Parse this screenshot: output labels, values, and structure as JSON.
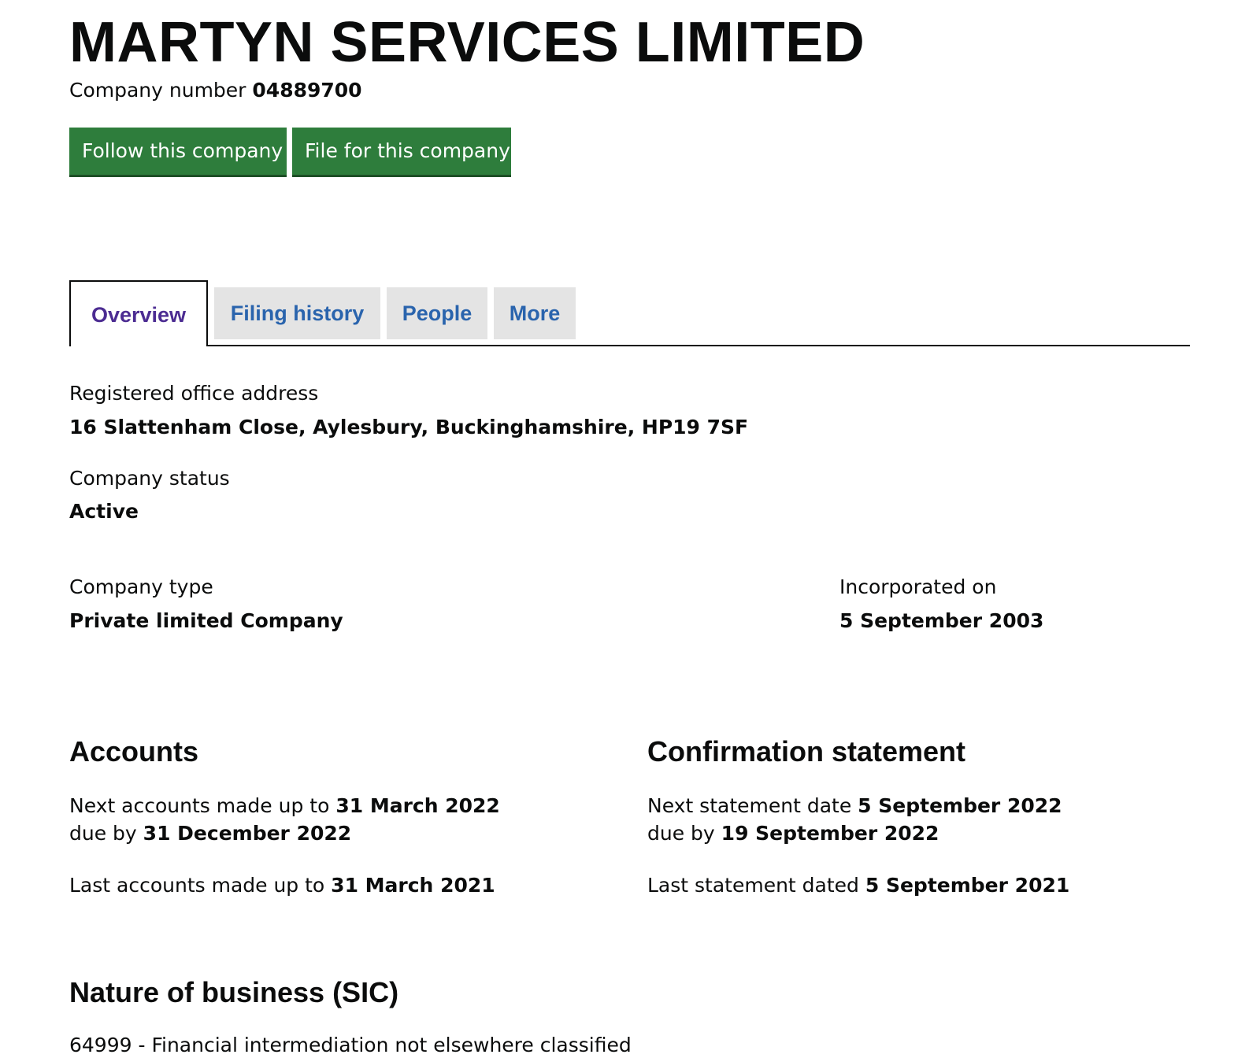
{
  "company": {
    "name": "MARTYN SERVICES LIMITED",
    "number_label": "Company number",
    "number": "04889700"
  },
  "actions": {
    "follow_label": "Follow this company",
    "file_label": "File for this company"
  },
  "tabs": [
    {
      "label": "Overview",
      "active": true
    },
    {
      "label": "Filing history",
      "active": false
    },
    {
      "label": "People",
      "active": false
    },
    {
      "label": "More",
      "active": false
    }
  ],
  "overview": {
    "address_label": "Registered office address",
    "address_value": "16 Slattenham Close, Aylesbury, Buckinghamshire, HP19 7SF",
    "status_label": "Company status",
    "status_value": "Active",
    "type_label": "Company type",
    "type_value": "Private limited Company",
    "incorporated_label": "Incorporated on",
    "incorporated_value": "5 September 2003"
  },
  "accounts": {
    "heading": "Accounts",
    "next_prefix": "Next accounts made up to",
    "next_date": "31 March 2022",
    "due_prefix": "due by",
    "due_date": "31 December 2022",
    "last_prefix": "Last accounts made up to",
    "last_date": "31 March 2021"
  },
  "confirmation": {
    "heading": "Confirmation statement",
    "next_prefix": "Next statement date",
    "next_date": "5 September 2022",
    "due_prefix": "due by",
    "due_date": "19 September 2022",
    "last_prefix": "Last statement dated",
    "last_date": "5 September 2021"
  },
  "sic": {
    "heading": "Nature of business (SIC)",
    "entry": "64999 - Financial intermediation not elsewhere classified"
  },
  "colors": {
    "button_green": "#2e7d3c",
    "tab_active_text": "#4c2c92",
    "tab_link_text": "#2a64ad",
    "tab_inactive_bg": "#e4e4e4",
    "text": "#0b0c0c"
  }
}
